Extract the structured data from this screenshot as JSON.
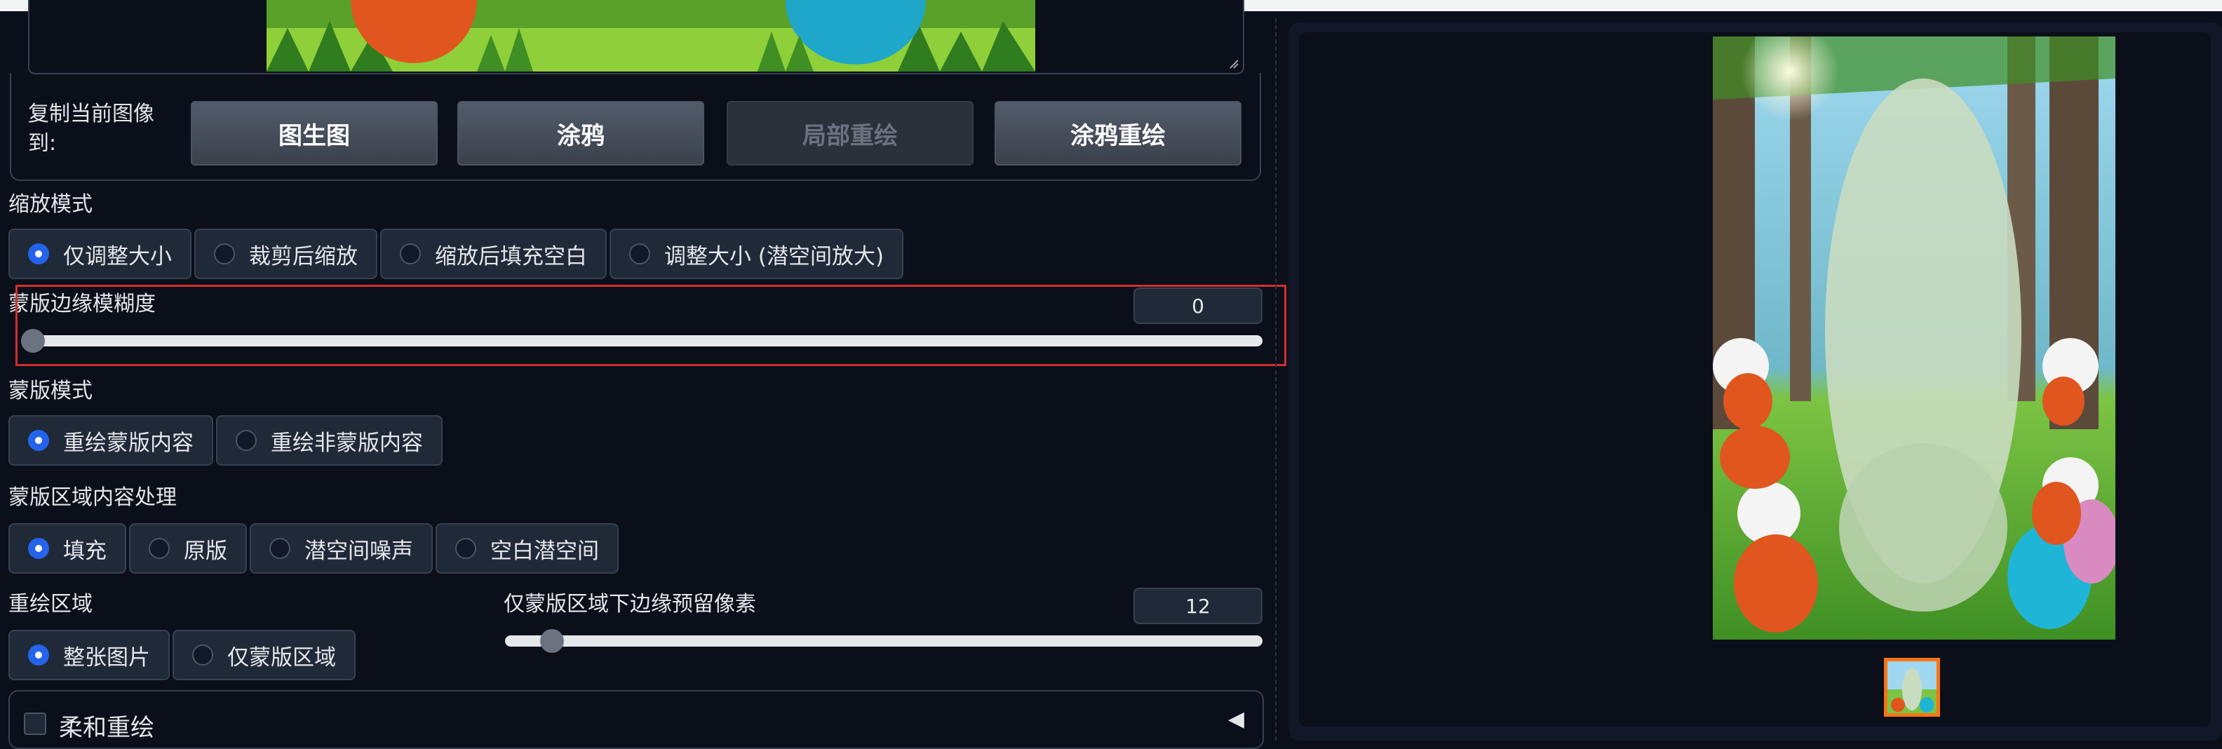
{
  "copy_section": {
    "label": "复制当前图像到:",
    "buttons": [
      {
        "label": "图生图",
        "enabled": true
      },
      {
        "label": "涂鸦",
        "enabled": true
      },
      {
        "label": "局部重绘",
        "enabled": false
      },
      {
        "label": "涂鸦重绘",
        "enabled": true
      }
    ]
  },
  "resize_mode": {
    "label": "缩放模式",
    "options": [
      "仅调整大小",
      "裁剪后缩放",
      "缩放后填充空白",
      "调整大小 (潜空间放大)"
    ],
    "selected": "仅调整大小"
  },
  "mask_blur": {
    "label": "蒙版边缘模糊度",
    "value": "0",
    "fraction": 0
  },
  "mask_mode": {
    "label": "蒙版模式",
    "options": [
      "重绘蒙版内容",
      "重绘非蒙版内容"
    ],
    "selected": "重绘蒙版内容"
  },
  "masked_content": {
    "label": "蒙版区域内容处理",
    "options": [
      "填充",
      "原版",
      "潜空间噪声",
      "空白潜空间"
    ],
    "selected": "填充"
  },
  "inpaint_area": {
    "label": "重绘区域",
    "options": [
      "整张图片",
      "仅蒙版区域"
    ],
    "selected": "整张图片"
  },
  "padding": {
    "label": "仅蒙版区域下边缘预留像素",
    "value": "12",
    "fraction": 0.047
  },
  "soft_inpaint": {
    "label": "柔和重绘",
    "arrow": "◀"
  },
  "colors": {
    "accent": "#2563eb",
    "highlight": "#d32f2f",
    "thumb_border": "#f97316"
  }
}
